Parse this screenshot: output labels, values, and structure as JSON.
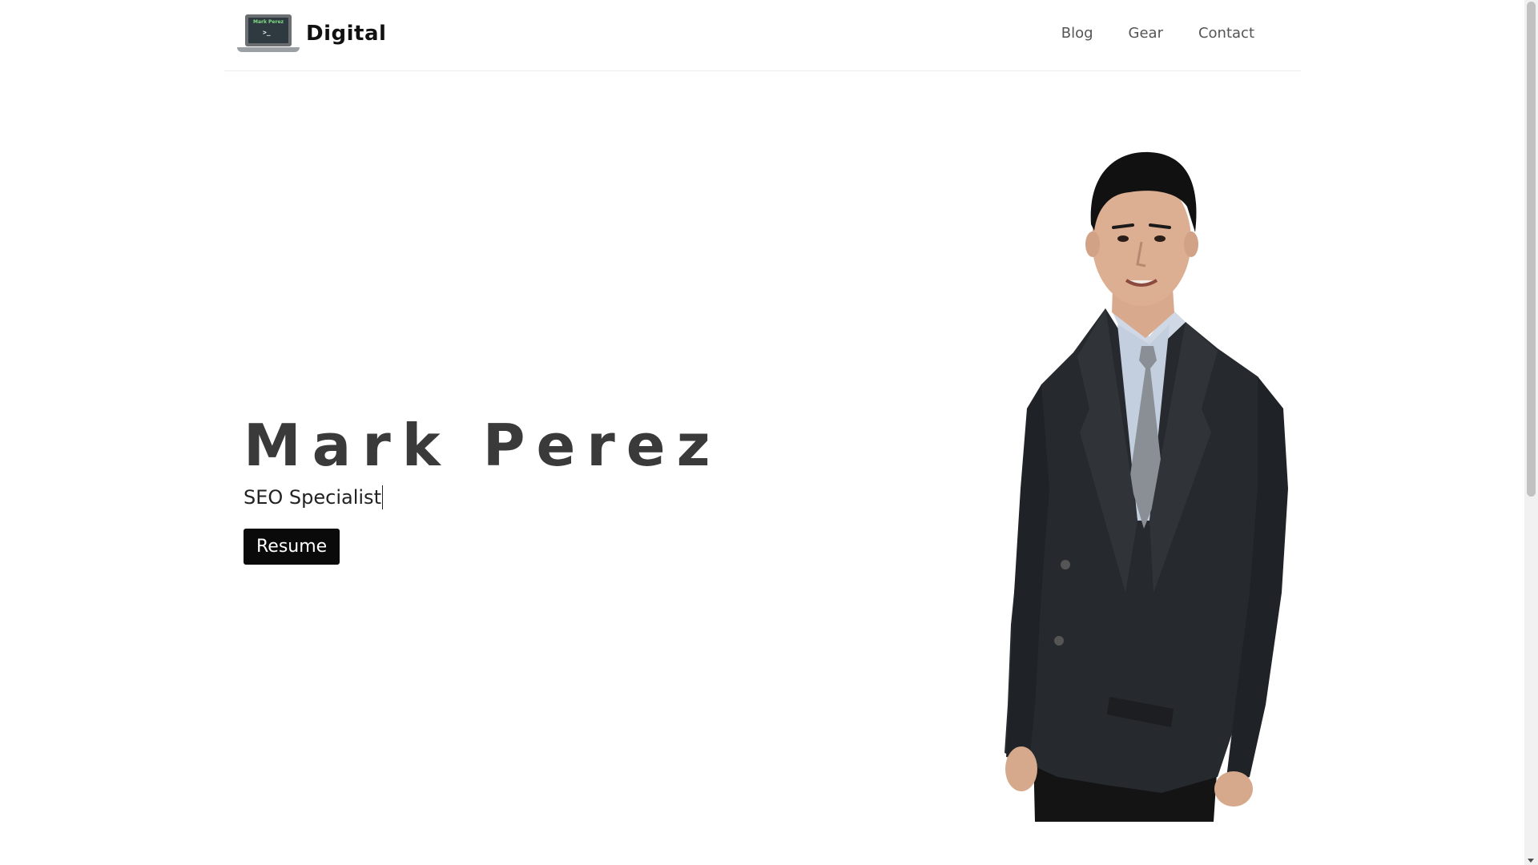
{
  "header": {
    "logo": {
      "screen_name": "Mark Perez",
      "screen_prompt": ">_",
      "icon": "laptop-terminal-icon"
    },
    "brand_text": "Digital",
    "nav": [
      {
        "label": "Blog"
      },
      {
        "label": "Gear"
      },
      {
        "label": "Contact"
      }
    ]
  },
  "hero": {
    "name": "Mark Perez",
    "role": "SEO Specialist",
    "button_label": "Resume",
    "portrait": "portrait-photo-man-in-dark-suit"
  },
  "colors": {
    "background": "#ffffff",
    "name_text": "#3a3a3a",
    "nav_text": "#555555",
    "button_bg": "#0a0a0a",
    "button_text": "#ffffff"
  }
}
